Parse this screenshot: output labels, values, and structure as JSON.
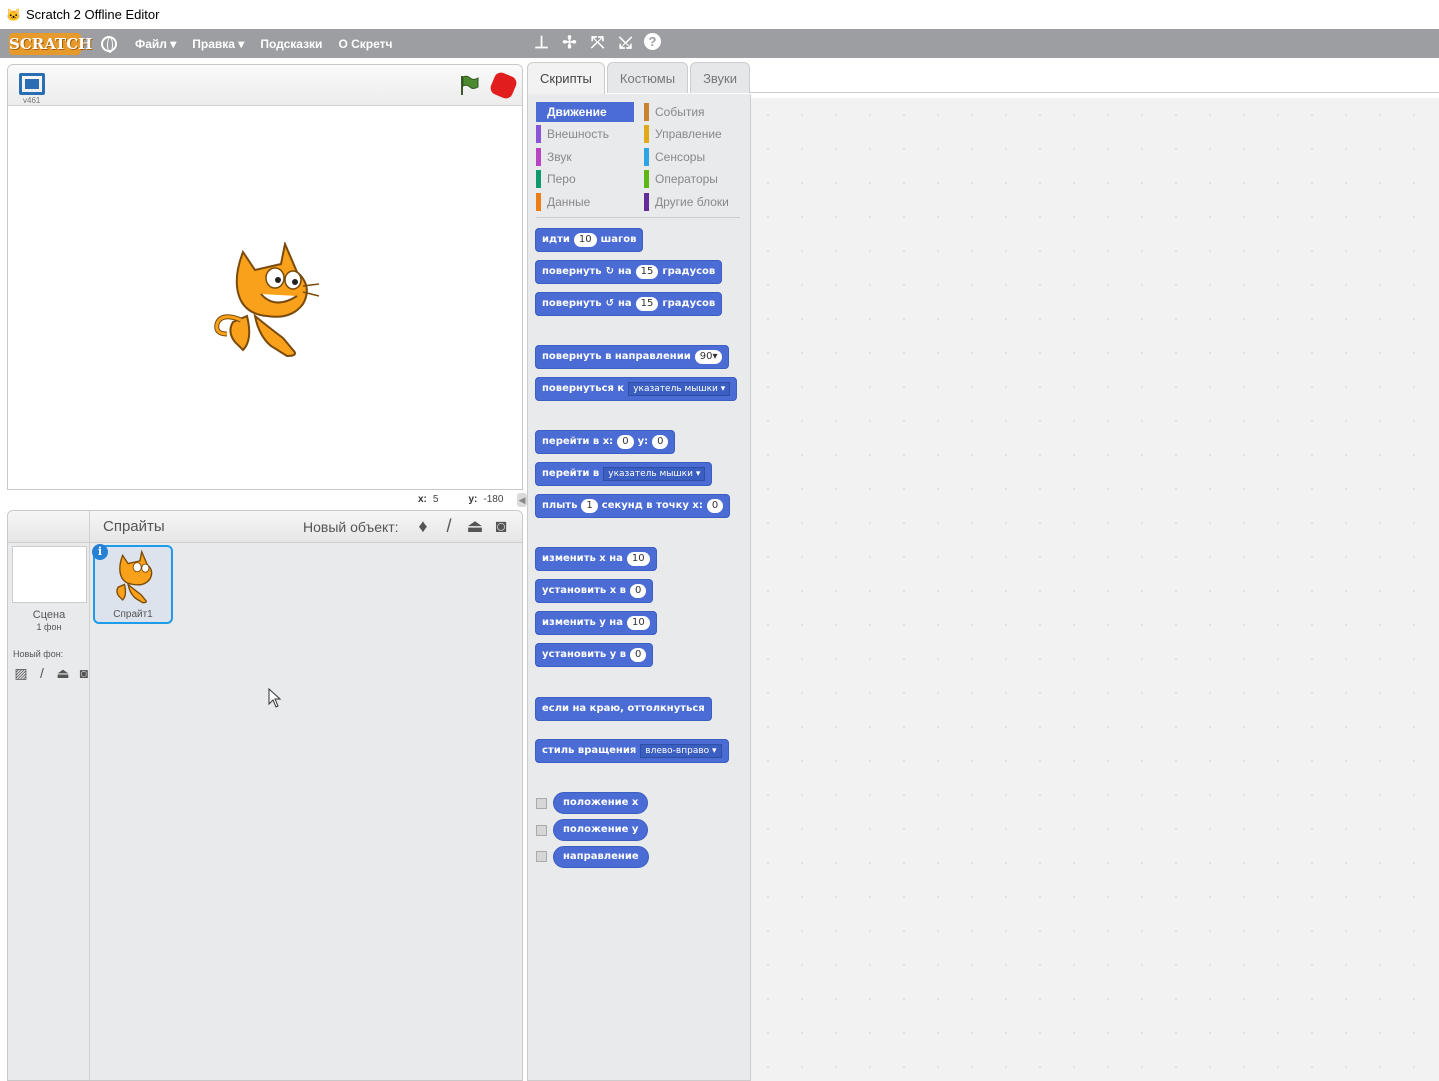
{
  "window": {
    "title": "Scratch 2 Offline Editor"
  },
  "menubar": {
    "logo": "SCRATCH",
    "items": [
      "Файл ▾",
      "Правка ▾",
      "Подсказки",
      "О Скретч"
    ]
  },
  "stage": {
    "version": "v461",
    "x_label": "x:",
    "x_value": "5",
    "y_label": "y:",
    "y_value": "-180"
  },
  "sprites": {
    "title": "Спрайты",
    "new_object": "Новый объект:",
    "stage_label": "Сцена",
    "stage_sub": "1 фон",
    "new_backdrop": "Новый фон:",
    "sprite_name": "Спрайт1"
  },
  "tabs": [
    "Скрипты",
    "Костюмы",
    "Звуки"
  ],
  "categories": [
    {
      "label": "Движение",
      "color": "#4a6cd4"
    },
    {
      "label": "События",
      "color": "#c88330"
    },
    {
      "label": "Внешность",
      "color": "#8a55d7"
    },
    {
      "label": "Управление",
      "color": "#e1a91a"
    },
    {
      "label": "Звук",
      "color": "#bb42c3"
    },
    {
      "label": "Сенсоры",
      "color": "#2ca5e2"
    },
    {
      "label": "Перо",
      "color": "#0e9a6c"
    },
    {
      "label": "Операторы",
      "color": "#5cb712"
    },
    {
      "label": "Данные",
      "color": "#ee7d16"
    },
    {
      "label": "Другие блоки",
      "color": "#632d99"
    }
  ],
  "blocks": {
    "move": {
      "a": "идти",
      "n": "10",
      "b": "шагов"
    },
    "turn_right": {
      "a": "повернуть",
      "icon": "↻",
      "b": "на",
      "n": "15",
      "c": "градусов"
    },
    "turn_left": {
      "a": "повернуть",
      "icon": "↺",
      "b": "на",
      "n": "15",
      "c": "градусов"
    },
    "point_dir": {
      "a": "повернуть в направлении",
      "n": "90▾"
    },
    "point_to": {
      "a": "повернуться к",
      "d": "указатель мышки ▾"
    },
    "goto_xy": {
      "a": "перейти в x:",
      "x": "0",
      "b": "y:",
      "y": "0"
    },
    "goto": {
      "a": "перейти в",
      "d": "указатель мышки ▾"
    },
    "glide": {
      "a": "плыть",
      "n": "1",
      "b": "секунд в точку x:",
      "x": "0"
    },
    "change_x": {
      "a": "изменить x на",
      "n": "10"
    },
    "set_x": {
      "a": "установить x в",
      "n": "0"
    },
    "change_y": {
      "a": "изменить y на",
      "n": "10"
    },
    "set_y": {
      "a": "установить y в",
      "n": "0"
    },
    "bounce": {
      "a": "если на краю, оттолкнуться"
    },
    "rotation": {
      "a": "стиль вращения",
      "d": "влево-вправо ▾"
    },
    "rep_x": "положение x",
    "rep_y": "положение y",
    "rep_dir": "направление"
  }
}
